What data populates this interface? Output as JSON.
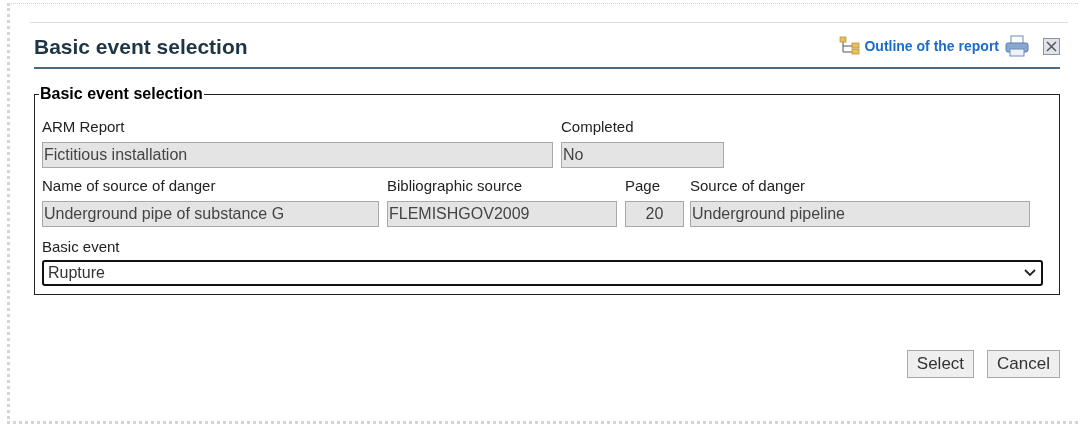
{
  "dialog": {
    "title": "Basic event selection",
    "outline_link": "Outline of the report"
  },
  "fieldset": {
    "legend": "Basic event selection",
    "rows": [
      [
        {
          "label": "ARM Report",
          "value": "Fictitious installation"
        },
        {
          "label": "Completed",
          "value": "No"
        }
      ],
      [
        {
          "label": "Name of source of danger",
          "value": "Underground pipe of substance G"
        },
        {
          "label": "Bibliographic source",
          "value": "FLEMISHGOV2009"
        },
        {
          "label": "Page",
          "value": "20"
        },
        {
          "label": "Source of danger",
          "value": "Underground pipeline"
        }
      ]
    ],
    "basic_event": {
      "label": "Basic event",
      "value": "Rupture"
    }
  },
  "buttons": [
    "Select",
    "Cancel"
  ]
}
